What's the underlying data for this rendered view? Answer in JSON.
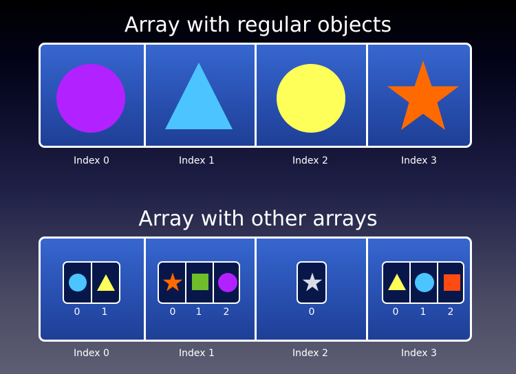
{
  "top": {
    "title": "Array with regular objects",
    "cells": [
      {
        "shape": "circle",
        "color": "#b221ff",
        "index_label": "Index 0"
      },
      {
        "shape": "triangle",
        "color": "#4bc4ff",
        "index_label": "Index 1"
      },
      {
        "shape": "circle",
        "color": "#ffff5a",
        "index_label": "Index 2"
      },
      {
        "shape": "star",
        "color": "#ff6a00",
        "index_label": "Index 3"
      }
    ]
  },
  "bottom": {
    "title": "Array with other arrays",
    "cells": [
      {
        "index_label": "Index 0",
        "sub_items": [
          {
            "shape": "circle",
            "color": "#4bc4ff",
            "label": "0"
          },
          {
            "shape": "triangle",
            "color": "#ffff5a",
            "label": "1"
          }
        ]
      },
      {
        "index_label": "Index 1",
        "sub_items": [
          {
            "shape": "star",
            "color": "#ff6a00",
            "label": "0"
          },
          {
            "shape": "square",
            "color": "#6fbd2b",
            "label": "1"
          },
          {
            "shape": "circle",
            "color": "#b221ff",
            "label": "2"
          }
        ]
      },
      {
        "index_label": "Index 2",
        "sub_items": [
          {
            "shape": "star",
            "color": "#d9dde6",
            "label": "0"
          }
        ]
      },
      {
        "index_label": "Index 3",
        "sub_items": [
          {
            "shape": "triangle",
            "color": "#ffff5a",
            "label": "0"
          },
          {
            "shape": "circle",
            "color": "#4bc4ff",
            "label": "1"
          },
          {
            "shape": "square",
            "color": "#ff4a12",
            "label": "2"
          }
        ]
      }
    ]
  }
}
